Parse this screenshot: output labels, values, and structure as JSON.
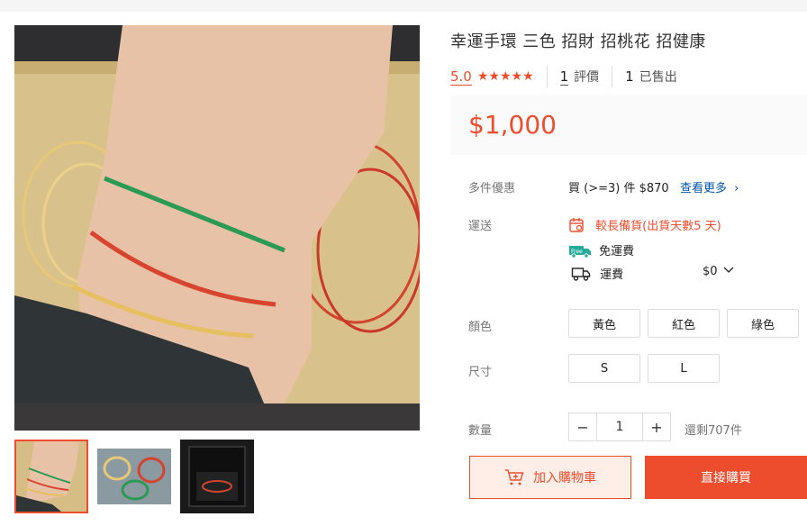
{
  "product": {
    "title": "幸運手環 三色 招財 招桃花 招健康",
    "rating": "5.0",
    "stars": "★★★★★",
    "reviews_count": "1",
    "reviews_label": "評價",
    "sold_count": "1",
    "sold_label": "已售出",
    "price": "$1,000"
  },
  "bulk": {
    "label": "多件優惠",
    "text": "買 (>=3) 件 $870",
    "more": "查看更多"
  },
  "shipping": {
    "label": "運送",
    "prep": "較長備貨(出貨天數5 天)",
    "free": "免運費",
    "free_badge": "Free",
    "fee_label": "運費",
    "fee_value": "$0"
  },
  "color": {
    "label": "顏色",
    "options": [
      "黃色",
      "紅色",
      "綠色"
    ]
  },
  "size": {
    "label": "尺寸",
    "options": [
      "S",
      "L"
    ]
  },
  "quantity": {
    "label": "數量",
    "value": "1",
    "minus": "−",
    "plus": "+",
    "stock": "還剩707件"
  },
  "actions": {
    "add_to_cart": "加入購物車",
    "buy_now": "直接購買"
  },
  "colors": {
    "accent": "#ee4d2d",
    "link": "#0055aa"
  }
}
